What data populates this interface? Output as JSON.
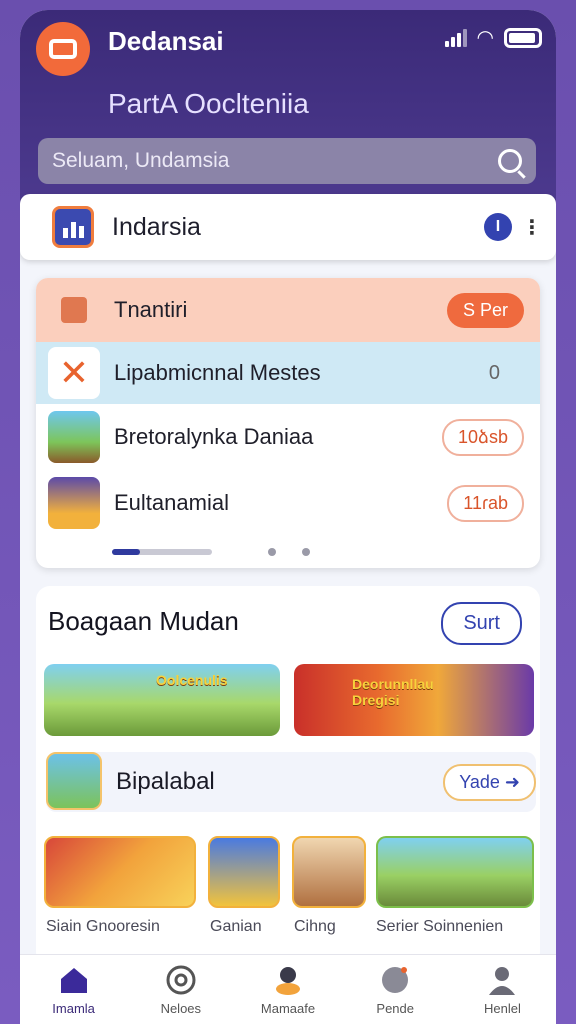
{
  "status_bar": {
    "signal": "signal-icon",
    "wifi": "wifi-icon",
    "battery": "battery-icon"
  },
  "header": {
    "app_name": "Dedansai",
    "subtitle": "PartA Ooclteniia",
    "search_placeholder": "Seluam, Undamsia"
  },
  "region": {
    "title": "Indarsia",
    "info": "I"
  },
  "ranking": {
    "top": {
      "label": "Tnantiri",
      "badge": "S Per"
    },
    "rows": [
      {
        "label": "Lipabmicnnal Mestes",
        "value": "0"
      },
      {
        "label": "Bretoralynka Daniaa",
        "value": "10ձsb"
      },
      {
        "label": "Eultanamial",
        "value": "11ɾab"
      }
    ]
  },
  "section": {
    "title": "Boagaan Mudan",
    "sort_label": "Surt",
    "banners": [
      {
        "text": "Oolcenulis"
      },
      {
        "text": "Deorunnllau Dregisi"
      }
    ],
    "sub": {
      "title": "Bipalabal",
      "button": "Yade ➜"
    },
    "tiles": [
      {
        "label": "Siain Gnooresin"
      },
      {
        "label": "Ganian"
      },
      {
        "label": "Cihng"
      },
      {
        "label": "Serier Soinnenien"
      }
    ]
  },
  "nav": {
    "items": [
      {
        "label": "Imamla",
        "icon": "home-icon"
      },
      {
        "label": "Neloes",
        "icon": "globe-icon"
      },
      {
        "label": "Mamaafe",
        "icon": "character-icon"
      },
      {
        "label": "Pende",
        "icon": "compass-icon"
      },
      {
        "label": "Henlel",
        "icon": "profile-icon"
      }
    ]
  },
  "colors": {
    "header": "#3b2a78",
    "accent": "#ef6a3e",
    "primary": "#3343b0"
  }
}
